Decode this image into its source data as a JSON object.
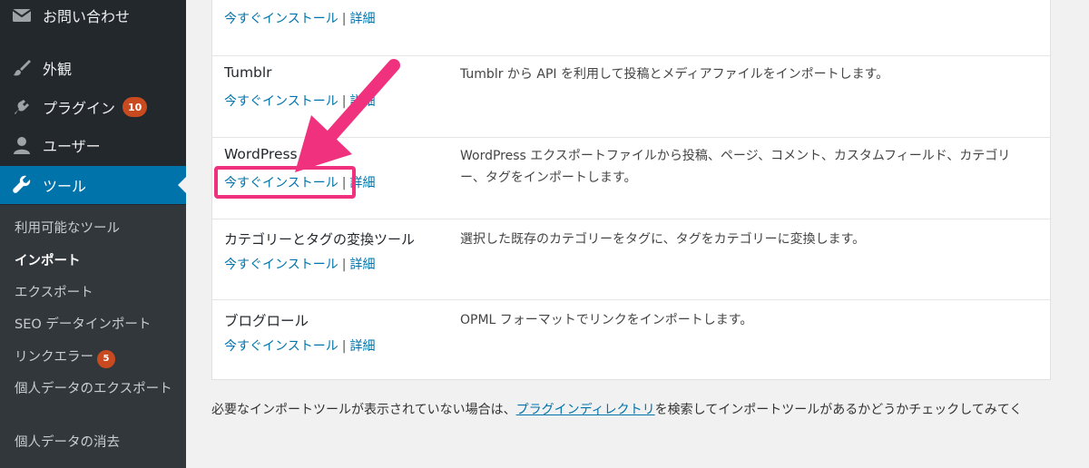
{
  "sidebar": {
    "items": [
      {
        "label": "お問い合わせ",
        "icon": "mail-icon"
      },
      {
        "label": "外観",
        "icon": "paintbrush-icon"
      },
      {
        "label": "プラグイン",
        "icon": "plugin-icon",
        "badge": "10"
      },
      {
        "label": "ユーザー",
        "icon": "user-icon"
      },
      {
        "label": "ツール",
        "icon": "wrench-icon",
        "active": true
      }
    ],
    "submenu": [
      {
        "label": "利用可能なツール"
      },
      {
        "label": "インポート",
        "current": true
      },
      {
        "label": "エクスポート"
      },
      {
        "label": "SEO データインポート"
      },
      {
        "label": "リンクエラー",
        "badge": "5"
      },
      {
        "label": "個人データのエクスポート"
      },
      {
        "label": "個人データの消去"
      }
    ]
  },
  "importers": [
    {
      "title": "",
      "desc": "",
      "install": "今すぐインストール",
      "details": "詳細",
      "sep": "|"
    },
    {
      "title": "Tumblr",
      "desc": "Tumblr から API を利用して投稿とメディアファイルをインポートします。",
      "install": "今すぐインストール",
      "details": "詳細",
      "sep": "|"
    },
    {
      "title": "WordPress",
      "desc": "WordPress エクスポートファイルから投稿、ページ、コメント、カスタムフィールド、カテゴリー、タグをインポートします。",
      "install": "今すぐインストール",
      "details": "詳細",
      "sep": "|"
    },
    {
      "title": "カテゴリーとタグの変換ツール",
      "desc": "選択した既存のカテゴリーをタグに、タグをカテゴリーに変換します。",
      "install": "今すぐインストール",
      "details": "詳細",
      "sep": "|"
    },
    {
      "title": "ブログロール",
      "desc": "OPML フォーマットでリンクをインポートします。",
      "install": "今すぐインストール",
      "details": "詳細",
      "sep": "|"
    }
  ],
  "footer": {
    "prefix": "必要なインポートツールが表示されていない場合は、",
    "link": "プラグインディレクトリ",
    "suffix": "を検索してインポートツールがあるかどうかチェックしてみてく"
  },
  "colors": {
    "accent": "#0073aa",
    "highlight": "#f0327e",
    "badge": "#ca4a1f"
  }
}
